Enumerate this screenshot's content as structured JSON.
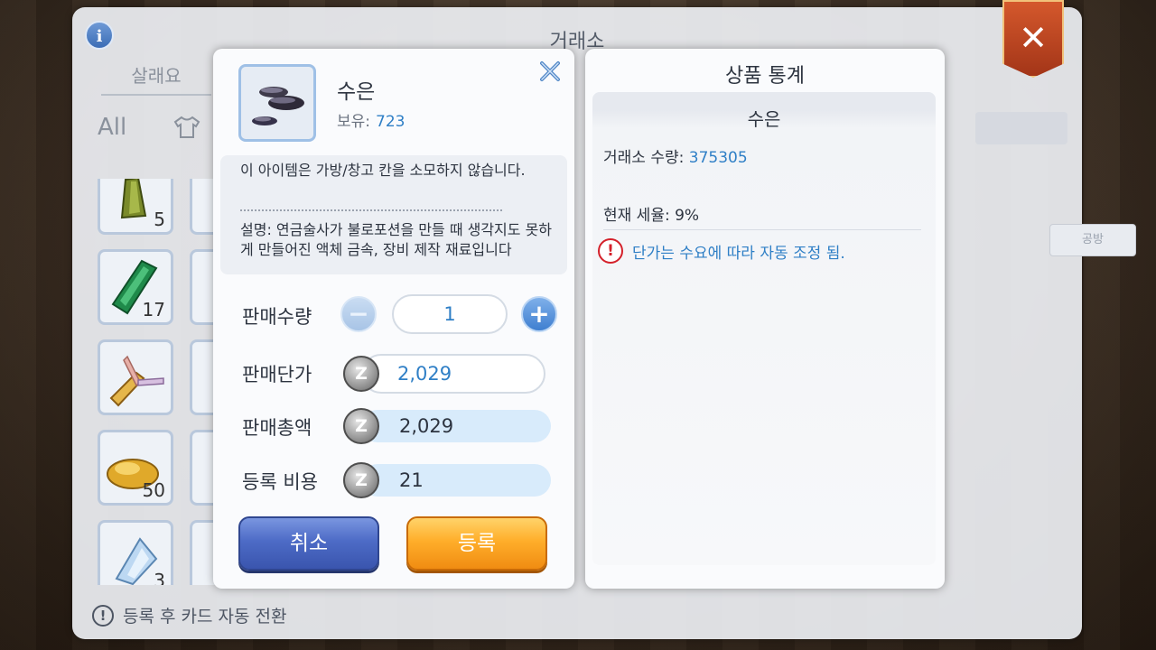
{
  "background": {
    "window_title": "거래소",
    "tab_buy": "살래요",
    "filter_all": "All",
    "side_button": "공방",
    "inventory": [
      {
        "count": "5"
      },
      {
        "count": "17"
      },
      {
        "count": ""
      },
      {
        "count": "50"
      },
      {
        "count": "3"
      }
    ],
    "bottom_note": "등록 후 카드 자동 전환"
  },
  "sell_dialog": {
    "item_name": "수은",
    "own_label": "보유:",
    "own_value": "723",
    "desc_line1": "이 아이템은 가방/창고 칸을 소모하지 않습니다.",
    "desc_line2": "설명: 연금술사가 불로포션을 만들 때 생각지도 못하게 만들어진 액체 금속, 장비 제작 재료입니다",
    "qty_label": "판매수량",
    "qty_value": "1",
    "unit_price_label": "판매단가",
    "unit_price_value": "2,029",
    "total_label": "판매총액",
    "total_value": "2,029",
    "fee_label": "등록 비용",
    "fee_value": "21",
    "zeny_symbol": "Z",
    "cancel_label": "취소",
    "register_label": "등록"
  },
  "stats_panel": {
    "title": "상품 통계",
    "item_name": "수은",
    "exchange_qty_label": "거래소 수량:",
    "exchange_qty_value": "375305",
    "tax_label": "현재 세율:",
    "tax_value": "9%",
    "notice": "단가는 수요에 따라 자동 조정 됨."
  },
  "colors": {
    "accent_blue": "#2f7fc6",
    "cancel_button": "#4d6bc6",
    "register_button": "#ffae2a",
    "warning_red": "#d4202a"
  }
}
